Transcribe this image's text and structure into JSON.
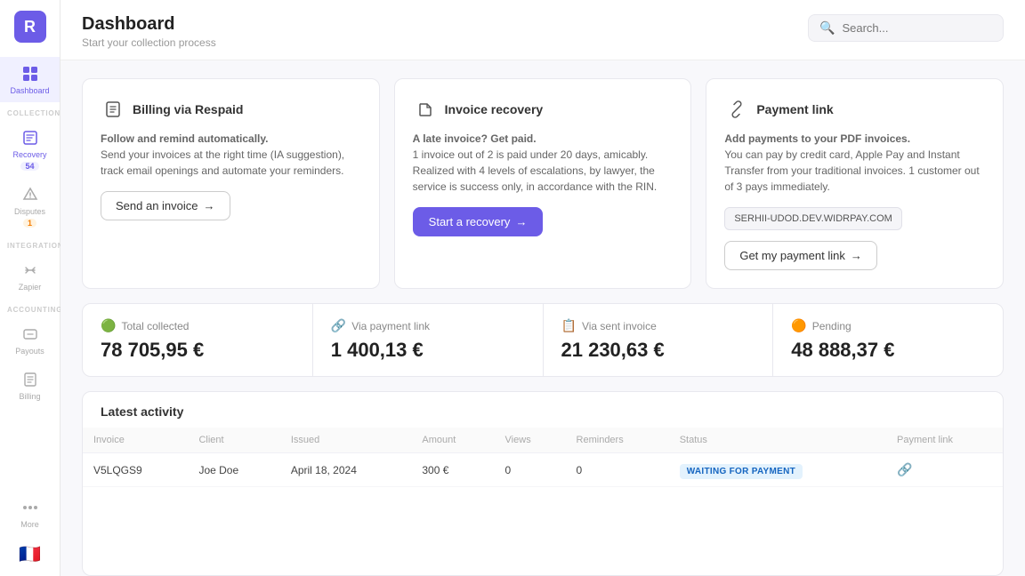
{
  "app": {
    "logo_letter": "R",
    "sidebar": {
      "section_collection": "COLLECTION",
      "section_integrations": "INTEGRATIONS",
      "section_accounting": "ACCOUNTING",
      "items": [
        {
          "label": "Dashboard",
          "icon": "grid",
          "active": true
        },
        {
          "label": "Recovery",
          "icon": "folder",
          "badge": "54",
          "badge_type": "normal"
        },
        {
          "label": "Disputes",
          "icon": "alert",
          "badge": "1",
          "badge_type": "orange"
        },
        {
          "label": "Zapier",
          "icon": "link"
        },
        {
          "label": "Payouts",
          "icon": "file"
        },
        {
          "label": "Billing",
          "icon": "receipt"
        },
        {
          "label": "More",
          "icon": "dots"
        }
      ],
      "flag": "🇫🇷"
    }
  },
  "header": {
    "title": "Dashboard",
    "subtitle": "Start your collection process",
    "search_placeholder": "Search..."
  },
  "cards": [
    {
      "id": "billing",
      "icon": "📄",
      "title": "Billing via Respaid",
      "desc_bold": "Follow and remind automatically.",
      "desc": "Send your invoices at the right time (IA suggestion), track email openings and automate your reminders.",
      "button_label": "Send an invoice",
      "button_type": "outline"
    },
    {
      "id": "recovery",
      "icon": "📁",
      "title": "Invoice recovery",
      "desc_bold": "A late invoice? Get paid.",
      "desc": "1 invoice out of 2 is paid under 20 days, amicably. Realized with 4 levels of escalations, by lawyer, the service is success only, in accordance with the RIN.",
      "button_label": "Start a recovery",
      "button_type": "primary"
    },
    {
      "id": "payment",
      "icon": "🔗",
      "title": "Payment link",
      "desc_bold": "Add payments to your PDF invoices.",
      "desc": "You can pay by credit card, Apple Pay and Instant Transfer from your traditional invoices. 1 customer out of 3 pays immediately.",
      "url": "SERHII-UDOD.DEV.WIDRPAY.COM",
      "button_label": "Get my payment link",
      "button_type": "outline"
    }
  ],
  "stats": [
    {
      "label": "Total collected",
      "icon": "💚",
      "value": "78 705,95 €"
    },
    {
      "label": "Via payment link",
      "icon": "🔗",
      "value": "1 400,13 €"
    },
    {
      "label": "Via sent invoice",
      "icon": "📋",
      "value": "21 230,63 €"
    },
    {
      "label": "Pending",
      "icon": "🟠",
      "value": "48 888,37 €"
    }
  ],
  "activity": {
    "title": "Latest activity",
    "columns": [
      "Invoice",
      "Client",
      "Issued",
      "Amount",
      "Views",
      "Reminders",
      "Status",
      "Payment link"
    ],
    "rows": [
      {
        "invoice": "V5LQGS9",
        "client": "Joe Doe",
        "issued": "April 18, 2024",
        "amount": "300 €",
        "views": "0",
        "reminders": "0",
        "status": "WAITING FOR PAYMENT",
        "has_link": true
      }
    ]
  },
  "colors": {
    "primary": "#6c5ce7",
    "accent_green": "#2ecc71",
    "accent_orange": "#f57c00"
  }
}
